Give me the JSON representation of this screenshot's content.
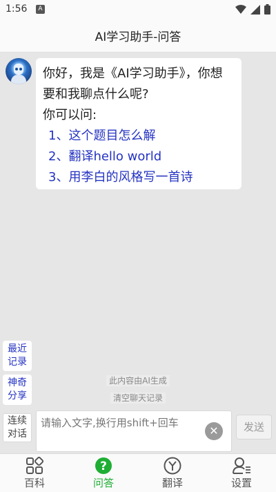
{
  "status_bar": {
    "time": "1:56",
    "notification_icon_letter": "A",
    "icons": [
      "wifi-icon",
      "signal-icon",
      "battery-icon"
    ]
  },
  "header": {
    "title": "AI学习助手-问答"
  },
  "message": {
    "lines": [
      "你好，我是《AI学习助手》，你想",
      "要和我聊点什么呢?",
      "你可以问:"
    ],
    "suggestions": [
      "1、这个题目怎么解",
      "2、翻译hello world",
      "3、用李白的风格写一首诗"
    ]
  },
  "side_buttons": {
    "recent": [
      "最近",
      "记录"
    ],
    "share": [
      "神奇",
      "分享"
    ],
    "continuous": [
      "连续",
      "对话"
    ]
  },
  "tips": {
    "ai_generated": "此内容由AI生成",
    "clear_history": "清空聊天记录"
  },
  "input": {
    "placeholder": "请输入文字,换行用shift+回车",
    "value": "",
    "send_label": "发送"
  },
  "tabs": [
    {
      "label": "百科",
      "icon": "grid-icon",
      "active": false
    },
    {
      "label": "问答",
      "icon": "question-icon",
      "active": true
    },
    {
      "label": "翻译",
      "icon": "translate-icon",
      "active": false
    },
    {
      "label": "设置",
      "icon": "user-settings-icon",
      "active": false
    }
  ],
  "colors": {
    "accent": "#1fae34",
    "link": "#2433c2",
    "background": "#e6e6e6"
  }
}
